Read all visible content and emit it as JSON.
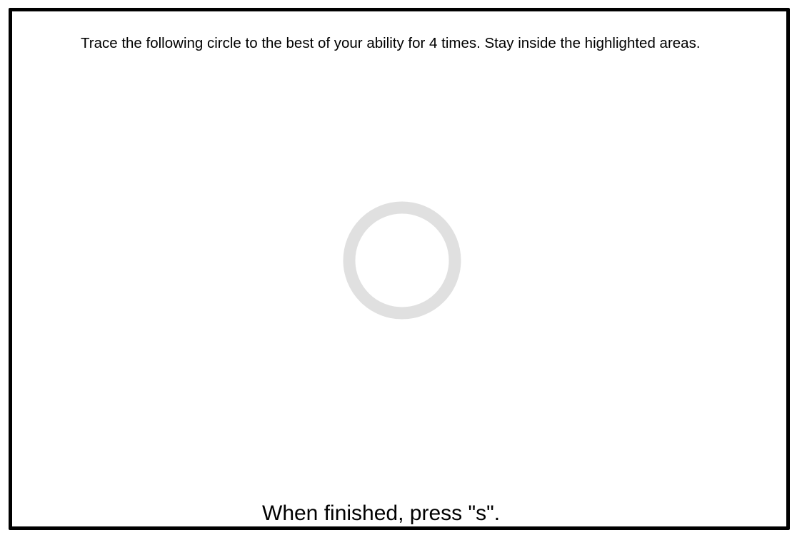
{
  "task": {
    "instruction": "Trace the following circle to the best of your ability for 4 times. Stay inside the highlighted areas.",
    "finish_hint": "When finished, press \"s\".",
    "trace_shape": "circle-icon",
    "colors": {
      "frame": "#000000",
      "highlight": "#e0e0e0",
      "background": "#ffffff",
      "text": "#000000"
    }
  }
}
